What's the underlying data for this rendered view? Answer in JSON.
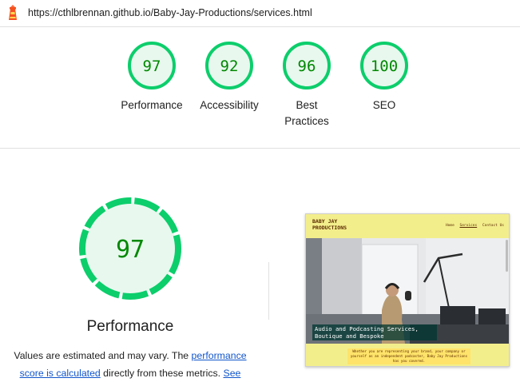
{
  "url": "https://cthlbrennan.github.io/Baby-Jay-Productions/services.html",
  "colors": {
    "pass": "#0cce6b",
    "pass_text": "#008800",
    "pass_fill": "#e8f8ee",
    "link": "#1155cc"
  },
  "icons": {
    "app_logo": "lighthouse-icon"
  },
  "gauges": [
    {
      "score": "97",
      "label": "Performance"
    },
    {
      "score": "92",
      "label": "Accessibility"
    },
    {
      "score": "96",
      "label_line1": "Best",
      "label_line2": "Practices"
    },
    {
      "score": "100",
      "label": "SEO"
    }
  ],
  "performance": {
    "score": "97",
    "title": "Performance",
    "note_prefix": "Values are estimated and may vary. The ",
    "note_link": "performance score is calculated",
    "note_middle": " directly from these metrics. ",
    "note_see": "See"
  },
  "screenshot": {
    "brand_line1": "BABY JAY",
    "brand_line2": "PRODUCTIONS",
    "nav": [
      "Home",
      "Services",
      "Contact Us"
    ],
    "hero_text": "Audio and Podcasting Services, Boutique and Bespoke",
    "paragraph": "Whether you are representing your brand, your company or yourself as an independent podcaster, Baby Jay Productions has you covered."
  }
}
